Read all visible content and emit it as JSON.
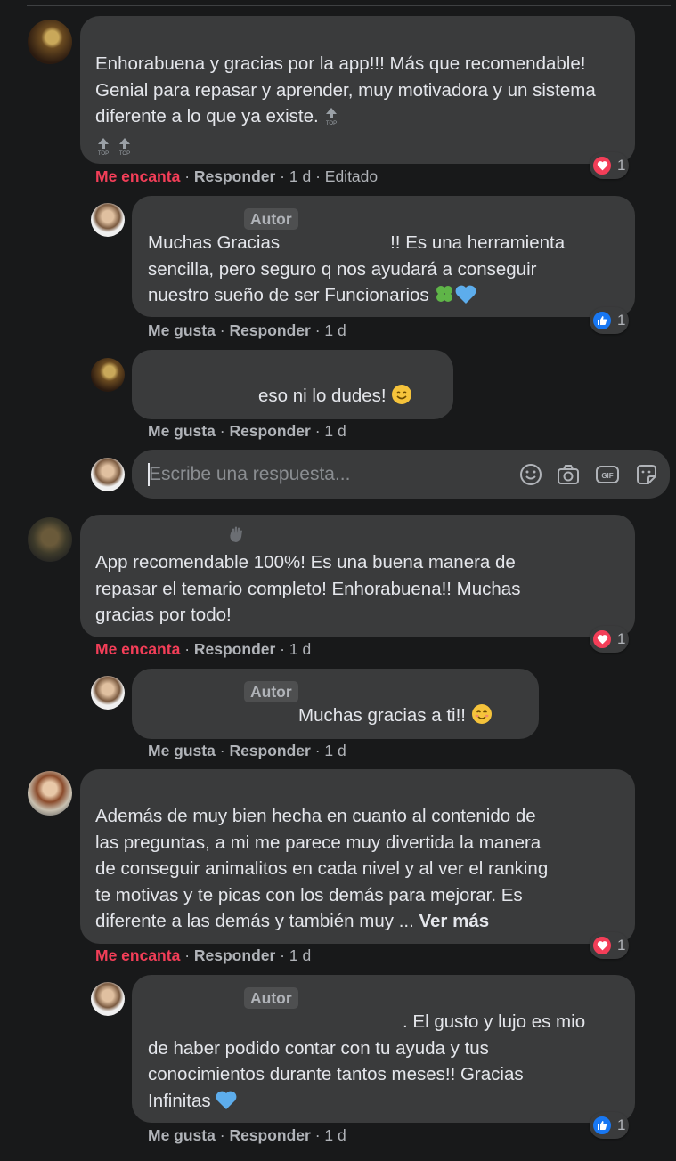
{
  "comments": [
    {
      "text": "Enhorabuena y gracias por la app!!! Más que recomendable! Genial para repasar y aprender, muy motivadora y un sistema diferente a lo que ya existe.",
      "actions": {
        "reaction": "Me encanta",
        "reply": "Responder",
        "time": "1 d",
        "edited": "Editado"
      },
      "reaction_count": "1",
      "replies": [
        {
          "badge": "Autor",
          "text_a": "Muchas Gracias",
          "text_b": "!! Es una herramienta",
          "text_c": "sencilla, pero seguro q nos ayudará a conseguir",
          "text_d": "nuestro sueño de ser Funcionarios",
          "actions": {
            "reaction": "Me gusta",
            "reply": "Responder",
            "time": "1 d"
          },
          "reaction_count": "1"
        },
        {
          "text": "eso ni lo dudes!",
          "actions": {
            "reaction": "Me gusta",
            "reply": "Responder",
            "time": "1 d"
          }
        }
      ],
      "reply_box": {
        "placeholder": "Escribe una respuesta..."
      }
    },
    {
      "text_lines": [
        "App recomendable 100%! Es una buena manera de",
        "repasar el temario completo! Enhorabuena!! Muchas",
        "gracias por todo!"
      ],
      "actions": {
        "reaction": "Me encanta",
        "reply": "Responder",
        "time": "1 d"
      },
      "reaction_count": "1",
      "reply": {
        "badge": "Autor",
        "text": "Muchas gracias a ti!!",
        "actions": {
          "reaction": "Me gusta",
          "reply": "Responder",
          "time": "1 d"
        }
      }
    },
    {
      "text_lines": [
        "Además de muy bien hecha en cuanto al contenido de",
        "las preguntas, a mi me parece muy divertida la manera",
        "de conseguir animalitos en cada nivel y al ver el ranking",
        "te motivas y te picas con los demás para mejorar. Es",
        "diferente a las demás y también muy ..."
      ],
      "see_more": "Ver más",
      "actions": {
        "reaction": "Me encanta",
        "reply": "Responder",
        "time": "1 d"
      },
      "reaction_count": "1",
      "reply": {
        "badge": "Autor",
        "text_lines": [
          ". El gusto y lujo es mio",
          "de haber podido contar con tu ayuda y tus",
          "conocimientos durante tantos meses!! Gracias",
          "Infinitas"
        ],
        "actions": {
          "reaction": "Me gusta",
          "reply": "Responder",
          "time": "1 d"
        },
        "reaction_count": "1"
      }
    }
  ],
  "colors": {
    "background": "#18191a",
    "bubble": "#3a3b3c",
    "love": "#f33e58",
    "like": "#1877f2",
    "muted": "#b0b3b8"
  }
}
